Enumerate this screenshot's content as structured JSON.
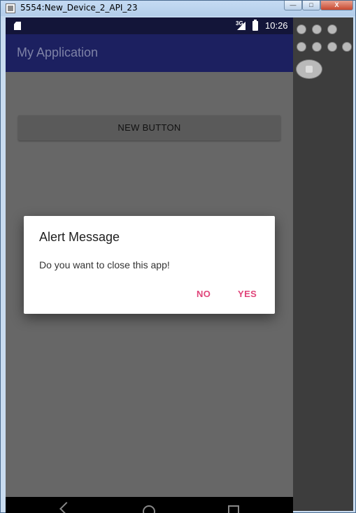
{
  "window": {
    "title": "5554:New_Device_2_API_23",
    "min_label": "—",
    "max_label": "□",
    "close_label": "X"
  },
  "statusbar": {
    "network": "3G",
    "time": "10:26",
    "sd_icon": "sd-card-icon",
    "signal_icon": "signal-icon",
    "battery_icon": "battery-icon"
  },
  "appbar": {
    "title": "My Application"
  },
  "main": {
    "new_button_label": "NEW BUTTON"
  },
  "dialog": {
    "title": "Alert Message",
    "message": "Do you want to close this app!",
    "no_label": "NO",
    "yes_label": "YES"
  },
  "colors": {
    "appbar": "#1c2060",
    "statusbar": "#131539",
    "dialog_button": "#e0457a",
    "scrim": "#676767"
  }
}
